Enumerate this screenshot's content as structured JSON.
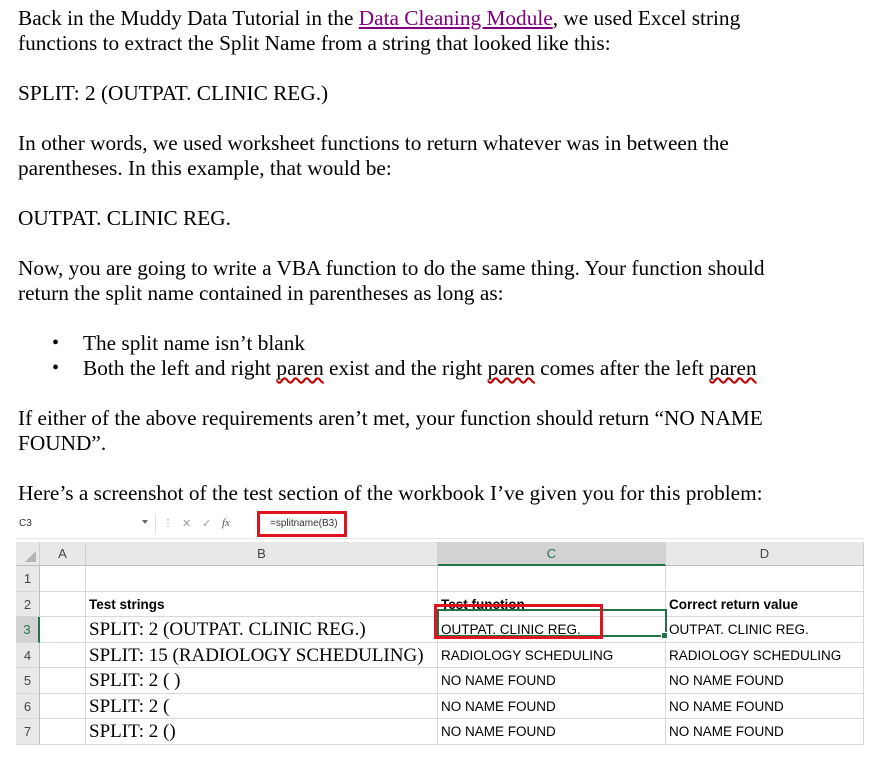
{
  "doc": {
    "p1_before": "Back in the Muddy Data Tutorial in the ",
    "p1_link": "Data Cleaning Module",
    "p1_after": ", we used Excel string",
    "p1_line2": "functions to extract the Split Name from a string that looked like this:",
    "sample": "SPLIT: 2 (OUTPAT. CLINIC REG.)",
    "p2_line1": "In other words, we used worksheet functions to return whatever was in between the",
    "p2_line2": "parentheses. In this example, that would be:",
    "result": "OUTPAT. CLINIC REG.",
    "p3_line1": "Now, you are going to write a VBA function to do the same thing. Your function should",
    "p3_line2": "return the split name contained in parentheses as long as:",
    "bullet1": "The split name isn’t blank",
    "bullet2_a": "Both the left and right ",
    "bullet2_paren1": "paren",
    "bullet2_b": " exist and the right ",
    "bullet2_paren2": "paren",
    "bullet2_c": " comes after the left ",
    "bullet2_paren3": "paren",
    "p4_line1": "If either of the above requirements aren’t met, your function should return “NO NAME",
    "p4_line2": "FOUND”.",
    "p5": "Here’s a screenshot of the test section of the workbook I’ve given you for this problem:"
  },
  "excel": {
    "name_box": "C3",
    "fx_label": "fx",
    "formula": "=splitname(B3)",
    "columns": [
      "A",
      "B",
      "C",
      "D"
    ],
    "rows": [
      {
        "num": "1",
        "b": "",
        "c": "",
        "d": ""
      },
      {
        "num": "2",
        "b": "Test strings",
        "c": "Test function",
        "d": "Correct return value"
      },
      {
        "num": "3",
        "b": "SPLIT: 2 (OUTPAT. CLINIC REG.)",
        "c": "OUTPAT. CLINIC REG.",
        "d": "OUTPAT. CLINIC REG."
      },
      {
        "num": "4",
        "b": "SPLIT: 15 (RADIOLOGY SCHEDULING)",
        "c": "RADIOLOGY SCHEDULING",
        "d": "RADIOLOGY SCHEDULING"
      },
      {
        "num": "5",
        "b": "SPLIT: 2 (      )",
        "c": "NO NAME FOUND",
        "d": "NO NAME FOUND"
      },
      {
        "num": "6",
        "b": "SPLIT: 2 (",
        "c": "NO NAME FOUND",
        "d": "NO NAME FOUND"
      },
      {
        "num": "7",
        "b": "SPLIT: 2 ()",
        "c": "NO NAME FOUND",
        "d": "NO NAME FOUND"
      }
    ],
    "highlight_color": "#e0141e",
    "selection_color": "#217346"
  }
}
